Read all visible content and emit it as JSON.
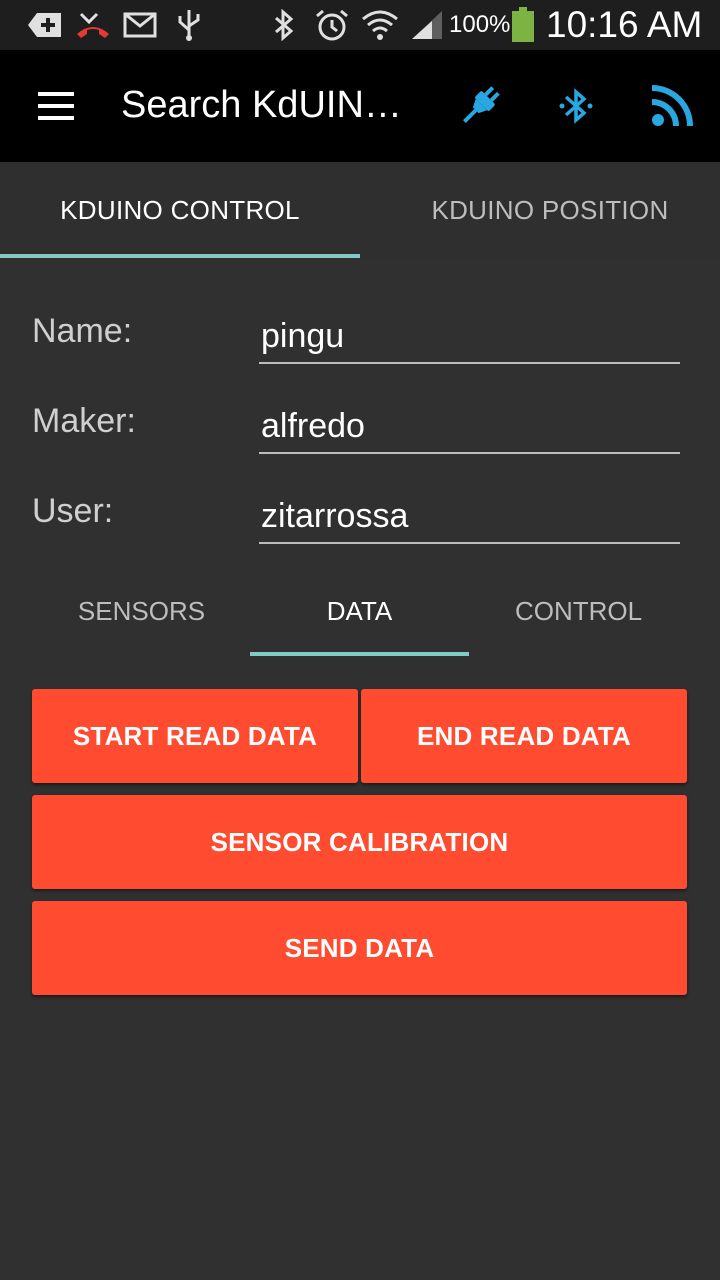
{
  "status_bar": {
    "icons": [
      "add-icon",
      "missed-call-icon",
      "mail-icon",
      "usb-icon",
      "bluetooth-icon",
      "alarm-icon",
      "wifi-icon",
      "signal-icon",
      "battery-icon"
    ],
    "battery_percent": "100%",
    "time": "10:16 AM",
    "battery_color": "#7cb342"
  },
  "toolbar": {
    "title": "Search KdUIN…",
    "actions": [
      "plug-icon",
      "bluetooth-searching-icon",
      "rss-icon"
    ],
    "action_color": "#29a7e1"
  },
  "top_tabs": [
    {
      "label": "KDUINO CONTROL",
      "active": true
    },
    {
      "label": "KDUINO POSITION",
      "active": false
    }
  ],
  "form": {
    "name_label": "Name:",
    "name_value": "pingu",
    "maker_label": "Maker:",
    "maker_value": "alfredo",
    "user_label": "User:",
    "user_value": "zitarrossa"
  },
  "sub_tabs": [
    {
      "label": "SENSORS",
      "active": false
    },
    {
      "label": "DATA",
      "active": true
    },
    {
      "label": "CONTROL",
      "active": false
    }
  ],
  "buttons": {
    "start_read": "START READ DATA",
    "end_read": "END READ DATA",
    "calibration": "SENSOR CALIBRATION",
    "send": "SEND DATA"
  },
  "colors": {
    "accent_button": "#ff4c30",
    "tab_indicator": "#80cbc4",
    "background": "#303030"
  }
}
